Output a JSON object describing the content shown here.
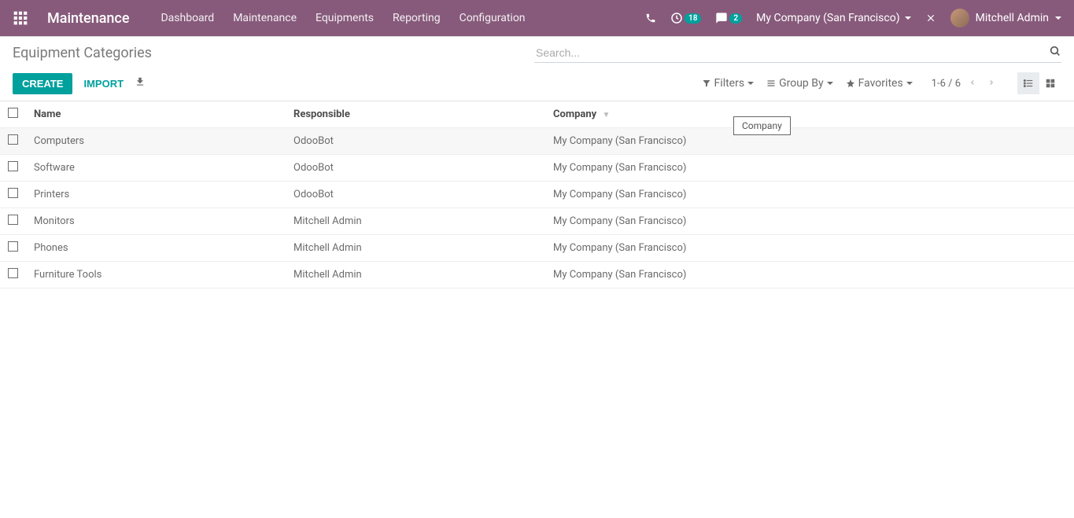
{
  "navbar": {
    "app_title": "Maintenance",
    "menu": [
      "Dashboard",
      "Maintenance",
      "Equipments",
      "Reporting",
      "Configuration"
    ],
    "activity_count": "18",
    "discuss_count": "2",
    "company": "My Company (San Francisco)",
    "user": "Mitchell Admin"
  },
  "breadcrumb": "Equipment Categories",
  "search": {
    "placeholder": "Search..."
  },
  "buttons": {
    "create": "CREATE",
    "import": "IMPORT"
  },
  "search_options": {
    "filters": "Filters",
    "group_by": "Group By",
    "favorites": "Favorites"
  },
  "pager": "1-6 / 6",
  "columns": {
    "name": "Name",
    "responsible": "Responsible",
    "company": "Company"
  },
  "tooltip": "Company",
  "rows": [
    {
      "name": "Computers",
      "responsible": "OdooBot",
      "company": "My Company (San Francisco)"
    },
    {
      "name": "Software",
      "responsible": "OdooBot",
      "company": "My Company (San Francisco)"
    },
    {
      "name": "Printers",
      "responsible": "OdooBot",
      "company": "My Company (San Francisco)"
    },
    {
      "name": "Monitors",
      "responsible": "Mitchell Admin",
      "company": "My Company (San Francisco)"
    },
    {
      "name": "Phones",
      "responsible": "Mitchell Admin",
      "company": "My Company (San Francisco)"
    },
    {
      "name": "Furniture Tools",
      "responsible": "Mitchell Admin",
      "company": "My Company (San Francisco)"
    }
  ]
}
